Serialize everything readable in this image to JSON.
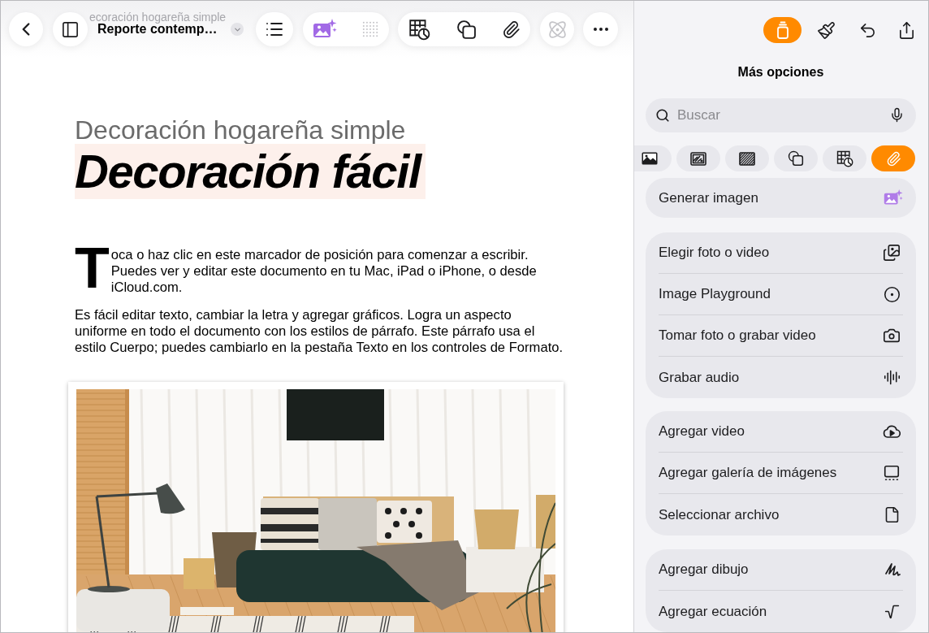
{
  "toolbar": {
    "header_behind": "ecoración hogareña simple",
    "document_title": "Reporte contemp…",
    "buttons": [
      {
        "disabled": false
      },
      {
        "disabled": false
      },
      {
        "disabled": false
      },
      {
        "disabled": false
      },
      {
        "disabled": true
      },
      {
        "disabled": false
      },
      {
        "disabled": false
      },
      {
        "disabled": false
      },
      {
        "disabled": true
      },
      {
        "disabled": false
      }
    ]
  },
  "document": {
    "subtitle": "Decoración hogareña simple",
    "title": "Decoración fácil",
    "paragraphs": [
      {
        "kind": "drop_cap",
        "text": "Toca o haz clic en este marcador de posición para comenzar a escribir. Puedes ver y editar este documento en tu Mac, iPad o iPhone, o desde iCloud.com."
      },
      {
        "kind": "body",
        "text": "Es fácil editar texto, cambiar la letra y agregar gráficos. Logra un aspecto uniforme en todo el documento con los estilos de párrafo. Este párrafo usa el estilo Cuerpo; puedes cambiarlo en la pestaña Texto en los controles de Formato."
      }
    ]
  },
  "inspector": {
    "modes": [
      {
        "selected": true
      },
      {
        "selected": false
      }
    ],
    "title": "Más opciones",
    "search": {
      "placeholder": "Buscar"
    },
    "categories": [
      {
        "selected": false
      },
      {
        "selected": false
      },
      {
        "selected": false
      },
      {
        "selected": false
      },
      {
        "selected": false
      },
      {
        "selected": true
      }
    ],
    "featured_item": {
      "label": "Generar imagen"
    },
    "groups": [
      {
        "items": [
          {
            "label": "Elegir foto o video"
          },
          {
            "label": "Image Playground"
          },
          {
            "label": "Tomar foto o grabar video"
          },
          {
            "label": "Grabar audio"
          }
        ]
      },
      {
        "items": [
          {
            "label": "Agregar video"
          },
          {
            "label": "Agregar galería de imágenes"
          },
          {
            "label": "Seleccionar archivo"
          }
        ]
      },
      {
        "items": [
          {
            "label": "Agregar dibujo"
          },
          {
            "label": "Agregar ecuación"
          }
        ]
      }
    ]
  }
}
